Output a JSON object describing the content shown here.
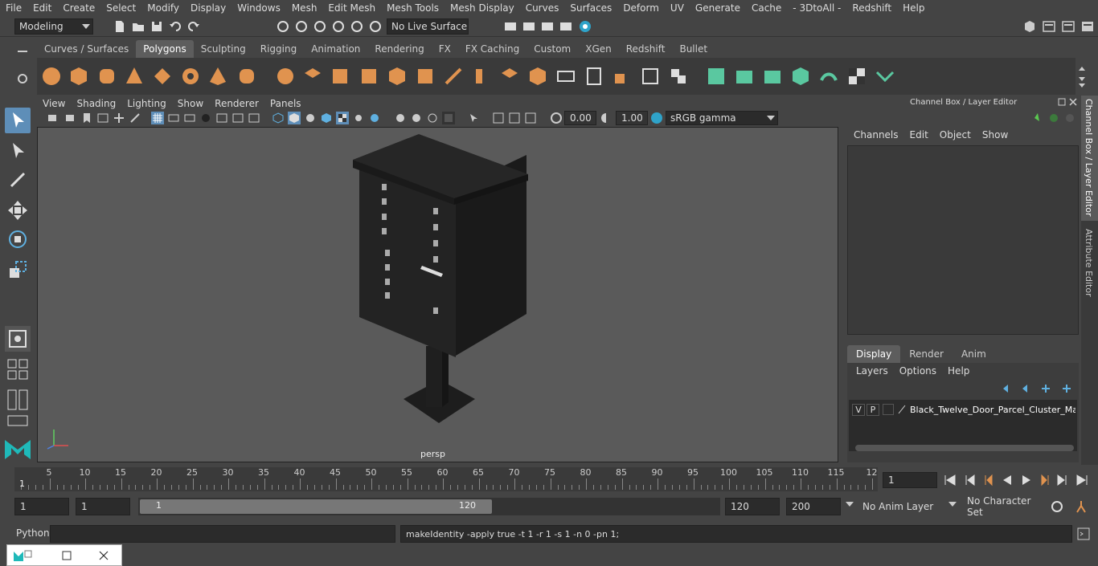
{
  "menubar": {
    "items": [
      "File",
      "Edit",
      "Create",
      "Select",
      "Modify",
      "Display",
      "Windows",
      "Mesh",
      "Edit Mesh",
      "Mesh Tools",
      "Mesh Display",
      "Curves",
      "Surfaces",
      "Deform",
      "UV",
      "Generate",
      "Cache",
      "- 3DtoAll -",
      "Redshift",
      "Help"
    ]
  },
  "statusline": {
    "mode": "Modeling",
    "live_surface": "No Live Surface"
  },
  "shelf": {
    "tabs": [
      "Curves / Surfaces",
      "Polygons",
      "Sculpting",
      "Rigging",
      "Animation",
      "Rendering",
      "FX",
      "FX Caching",
      "Custom",
      "XGen",
      "Redshift",
      "Bullet"
    ],
    "active_tab": "Polygons"
  },
  "panel": {
    "menus": [
      "View",
      "Shading",
      "Lighting",
      "Show",
      "Renderer",
      "Panels"
    ],
    "exposure": "0.00",
    "gamma": "1.00",
    "colorspace": "sRGB gamma",
    "camera_label": "persp"
  },
  "channelbox": {
    "title": "Channel Box / Layer Editor",
    "menus": [
      "Channels",
      "Edit",
      "Object",
      "Show"
    ]
  },
  "layers": {
    "tabs": [
      "Display",
      "Render",
      "Anim"
    ],
    "active_tab": "Display",
    "menus": [
      "Layers",
      "Options",
      "Help"
    ],
    "layer_v": "V",
    "layer_p": "P",
    "layer_name": "Black_Twelve_Door_Parcel_Cluster_Mailb"
  },
  "sidetabs": {
    "channel": "Channel Box / Layer Editor",
    "attribute": "Attribute Editor"
  },
  "timeline": {
    "ticks": [
      "5",
      "10",
      "15",
      "20",
      "25",
      "30",
      "35",
      "40",
      "45",
      "50",
      "55",
      "60",
      "65",
      "70",
      "75",
      "80",
      "85",
      "90",
      "95",
      "100",
      "105",
      "110",
      "115",
      "12"
    ],
    "start_label": "1",
    "current_frame": "1"
  },
  "range": {
    "start": "1",
    "playback_start": "1",
    "slider_start": "1",
    "slider_end": "120",
    "playback_end": "120",
    "end": "200",
    "anim_layer": "No Anim Layer",
    "character_set": "No Character Set"
  },
  "cmdline": {
    "language": "Python",
    "result": "makeIdentity -apply true -t 1 -r 1 -s 1 -n 0 -pn 1;"
  }
}
